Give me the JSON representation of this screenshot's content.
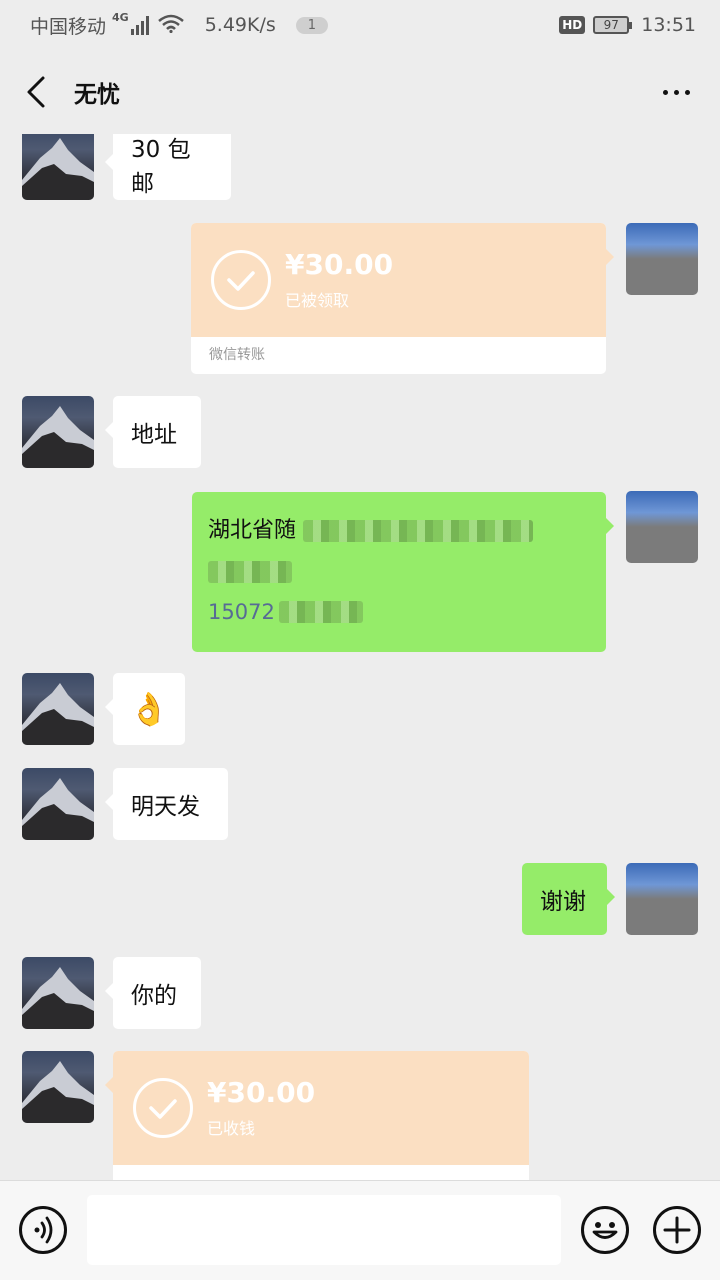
{
  "status_bar": {
    "carrier": "中国移动",
    "network": "4G",
    "speed": "5.49K/s",
    "notification_count": "1",
    "hd": "HD",
    "battery": "97",
    "time": "13:51"
  },
  "header": {
    "title": "无忧"
  },
  "messages": [
    {
      "side": "left",
      "type": "text",
      "text": "30 包邮"
    },
    {
      "side": "right",
      "type": "transfer",
      "amount": "¥30.00",
      "status": "已被领取",
      "footer": "微信转账"
    },
    {
      "side": "left",
      "type": "text",
      "text": "地址"
    },
    {
      "side": "right",
      "type": "address",
      "line1_visible_prefix": "湖北省随",
      "phone_visible_prefix": "15072"
    },
    {
      "side": "left",
      "type": "emoji",
      "emoji": "👌"
    },
    {
      "side": "left",
      "type": "text",
      "text": "明天发"
    },
    {
      "side": "right",
      "type": "text",
      "text": "谢谢"
    },
    {
      "side": "left",
      "type": "text",
      "text": "你的"
    },
    {
      "side": "left",
      "type": "transfer",
      "amount": "¥30.00",
      "status": "已收钱"
    }
  ],
  "input_bar": {
    "placeholder": ""
  },
  "icons": {
    "back": "back-chevron-icon",
    "more": "more-dots-icon",
    "voice": "voice-icon",
    "emoji": "emoji-icon",
    "plus": "plus-icon"
  },
  "colors": {
    "background": "#ededed",
    "green_bubble": "#95ec69",
    "transfer_orange": "#fbdfc2",
    "white_bubble": "#ffffff"
  }
}
